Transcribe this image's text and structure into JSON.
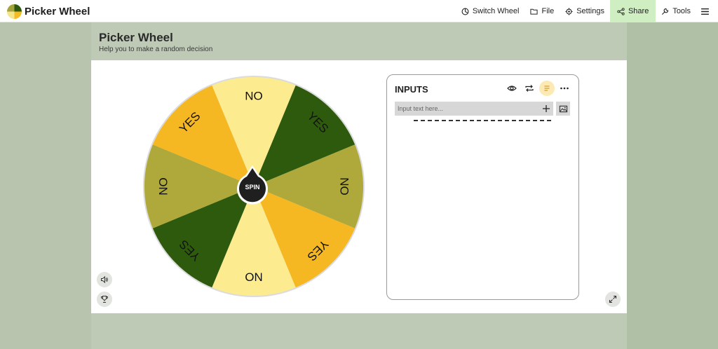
{
  "app": {
    "name": "Picker Wheel"
  },
  "nav": {
    "items": [
      {
        "label": "Switch Wheel",
        "icon": "switch-wheel-icon"
      },
      {
        "label": "File",
        "icon": "folder-icon"
      },
      {
        "label": "Settings",
        "icon": "gear-icon"
      },
      {
        "label": "Share",
        "icon": "share-icon"
      },
      {
        "label": "Tools",
        "icon": "wrench-icon"
      }
    ],
    "menu_icon": "hamburger-menu-icon"
  },
  "header": {
    "title": "Picker Wheel",
    "subtitle": "Help you to make a random decision"
  },
  "wheel": {
    "segments": [
      {
        "label": "NO",
        "color": "#fdeb90"
      },
      {
        "label": "YES",
        "color": "#2e5a0e"
      },
      {
        "label": "NO",
        "color": "#aea93a"
      },
      {
        "label": "YES",
        "color": "#f6b822"
      },
      {
        "label": "NO",
        "color": "#fdeb90"
      },
      {
        "label": "YES",
        "color": "#2e5a0e"
      },
      {
        "label": "NO",
        "color": "#aea93a"
      },
      {
        "label": "YES",
        "color": "#f6b822"
      }
    ],
    "spin_label": "SPIN"
  },
  "inputs": {
    "title": "INPUTS",
    "placeholder": "Input text here...",
    "value": "",
    "icons": [
      "eye-icon",
      "repeat-icon",
      "list-icon",
      "more-icon"
    ]
  },
  "controls": {
    "sound_icon": "speaker-icon",
    "trophy_icon": "trophy-icon",
    "fullscreen_icon": "expand-icon"
  }
}
